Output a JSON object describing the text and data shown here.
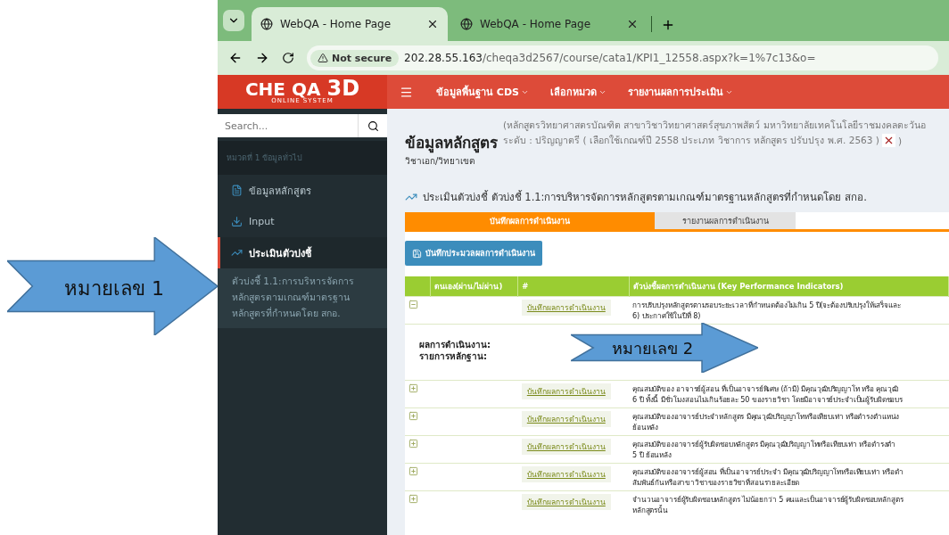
{
  "browser": {
    "tabs": [
      {
        "title": "WebQA - Home Page",
        "selected": true
      },
      {
        "title": "WebQA - Home Page",
        "selected": false
      }
    ],
    "security": "Not secure",
    "url_host": "202.28.55.163",
    "url_path": "/cheqa3d2567/course/cata1/KPI1_12558.aspx?k=1%7c13&o="
  },
  "navbar": {
    "logo": "CHE QA",
    "logo_big": "3D",
    "logo_sub": "ONLINE SYSTEM",
    "menus": [
      "ข้อมูลพื้นฐาน CDS",
      "เลือกหมวด",
      "รายงานผลการประเมิน"
    ]
  },
  "sidebar": {
    "search": {
      "placeholder": "Search..."
    },
    "section": "หมวดที่ 1 ข้อมูลทั่วไป",
    "items": [
      {
        "kind": "doc",
        "label": "ข้อมูลหลักสูตร",
        "selected": false
      },
      {
        "kind": "input",
        "label": "Input",
        "selected": false
      },
      {
        "kind": "chart",
        "label": "ประเมินตัวบ่งชี้",
        "selected": true
      }
    ],
    "subitem": "ตัวบ่งชี้ 1.1:การบริหารจัดการหลักสูตรตามเกณฑ์มาตรฐานหลักสูตรที่กำหนดโดย สกอ."
  },
  "header": {
    "title": "ข้อมูลหลักสูตร",
    "subtitle": "วิชาเอก/วิทยาเขต",
    "info_line": "(หลักสูตรวิทยาศาสตรบัณฑิต สาขาวิชาวิทยาศาสตร์สุขภาพสัตว์ มหาวิทยาลัยเทคโนโลยีราชมงคลตะวันอ",
    "level_line": "ระดับ : ปริญญาตรี ( เลือกใช้เกณฑ์ปี 2558 ประเภท วิชาการ หลักสูตร ปรับปรุง พ.ศ. 2563 )",
    "level_end": ")"
  },
  "heading": "ประเมินตัวบ่งชี้ ตัวบ่งชี้ 1.1:การบริหารจัดการหลักสูตรตามเกณฑ์มาตรฐานหลักสูตรที่กำหนดโดย สกอ.",
  "page_tabs": [
    {
      "label": "บันทึกผลการดำเนินงาน",
      "selected": true
    },
    {
      "label": "รายงานผลการดำเนินงาน",
      "selected": false
    }
  ],
  "process_button": "บันทึกประมวลผลการดำเนินงาน",
  "table": {
    "columns": [
      "ตนเอง(ผ่าน/ไม่ผ่าน)",
      "#",
      "ตัวบ่งชี้ผลการดำเนินงาน (Key Performance Indicators)"
    ],
    "detail_labels": [
      "ผลการดำเนินงาน:",
      "รายการหลักฐาน:"
    ],
    "rows": [
      {
        "expanded": true,
        "link": "บันทึกผลการดำเนินงาน",
        "kpi": [
          "การปรับปรุงหลักสูตรตามรอบระยะเวลาที่กำหนดต้องไม่เกิน 5 ปี(จะต้องปรับปรุงให้เสร็จและ",
          "6) ประกาศใช้ในปีที่ 8)"
        ]
      },
      {
        "expanded": false,
        "link": "บันทึกผลการดำเนินงาน",
        "kpi": [
          "คุณสมบัติของ อาจารย์ผู้สอน ที่เป็นอาจารย์พิเศษ (ถ้ามี) มีคุณวุฒิปริญญาโท หรือ คุณวุฒิ",
          "6 ปี ทั้งนี้ มีชั่วโมงสอนไม่เกินร้อยละ 50 ของรายวิชา โดยมีอาจารย์ประจำเป็นผู้รับผิดชอบร"
        ]
      },
      {
        "expanded": false,
        "link": "บันทึกผลการดำเนินงาน",
        "kpi": [
          "คุณสมบัติของอาจารย์ประจำหลักสูตร มีคุณวุฒิปริญญาโทหรือเทียบเท่า หรือดำรงตำแหน่ง",
          "ย้อนหลัง"
        ]
      },
      {
        "expanded": false,
        "link": "บันทึกผลการดำเนินงาน",
        "kpi": [
          "คุณสมบัติของอาจารย์ผู้รับผิดชอบหลักสูตร มีคุณวุฒิปริญญาโทหรือเทียบเท่า หรือดำรงตำ",
          "5 ปี ย้อนหลัง"
        ]
      },
      {
        "expanded": false,
        "link": "บันทึกผลการดำเนินงาน",
        "kpi": [
          "คุณสมบัติของอาจารย์ผู้สอน ที่เป็นอาจารย์ประจำ มีคุณวุฒิปริญญาโทหรือเทียบเท่า หรือดำ",
          "สัมพันธ์กันหรือสาขาวิชาของรายวิชาที่สอนรายละเอียด"
        ]
      },
      {
        "expanded": false,
        "link": "บันทึกผลการดำเนินงาน",
        "kpi": [
          "จำนวนอาจารย์ผู้รับผิดชอบหลักสูตร ไม่น้อยกว่า 5 คนและเป็นอาจารย์ผู้รับผิดชอบหลักสูตร",
          "หลักสูตรนั้น"
        ]
      }
    ]
  },
  "annotations": [
    {
      "label": "หมายเลข 1"
    },
    {
      "label": "หมายเลข 2"
    }
  ]
}
